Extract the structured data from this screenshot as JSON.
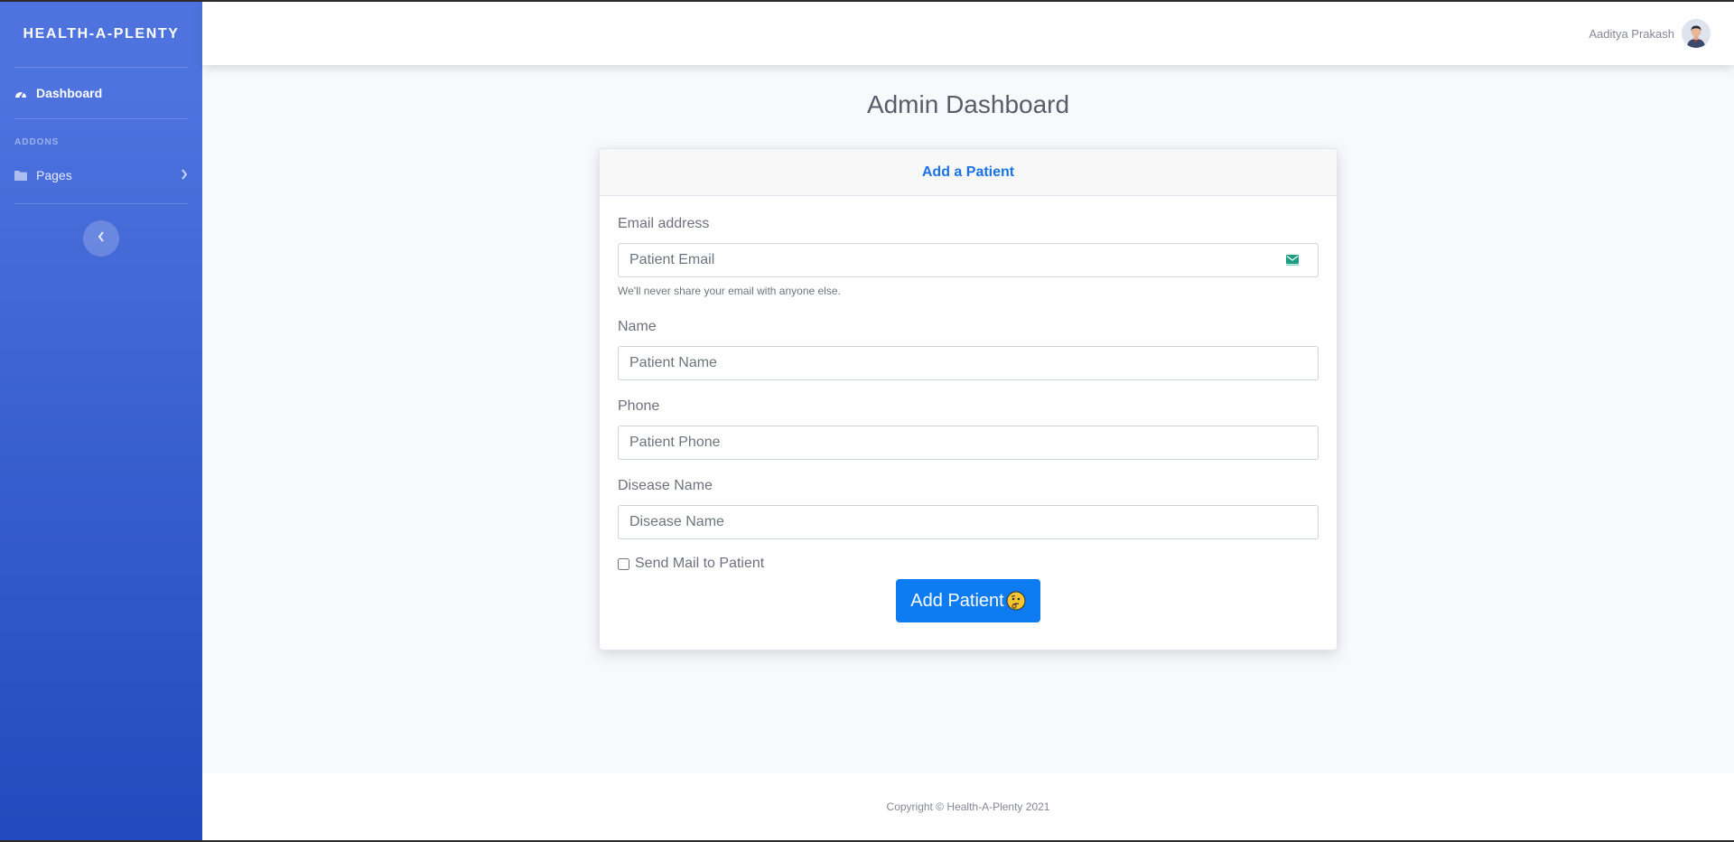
{
  "sidebar": {
    "brand": "HEALTH-A-PLENTY",
    "dashboard_label": "Dashboard",
    "section_heading": "ADDONS",
    "pages_label": "Pages"
  },
  "topbar": {
    "user_name": "Aaditya Prakash"
  },
  "main": {
    "title": "Admin Dashboard",
    "card_title": "Add a Patient",
    "email": {
      "label": "Email address",
      "placeholder": "Patient Email",
      "help": "We'll never share your email with anyone else."
    },
    "name": {
      "label": "Name",
      "placeholder": "Patient Name"
    },
    "phone": {
      "label": "Phone",
      "placeholder": "Patient Phone"
    },
    "disease": {
      "label": "Disease Name",
      "placeholder": "Disease Name"
    },
    "send_mail_label": "Send Mail to Patient",
    "submit_label": "Add Patient"
  },
  "footer": {
    "copyright": "Copyright © Health-A-Plenty 2021"
  },
  "colors": {
    "sidebar_top": "#4e73df",
    "sidebar_bottom": "#224abe",
    "primary_button": "#0d7cf2",
    "card_title": "#1a73e8"
  },
  "icons": {
    "dashboard": "tachometer-icon",
    "pages": "folder-icon",
    "pages_chevron": "chevron-right-icon",
    "toggler": "chevron-left-icon",
    "email_field": "mail-icon",
    "button_emoji": "thinking-face-icon"
  }
}
